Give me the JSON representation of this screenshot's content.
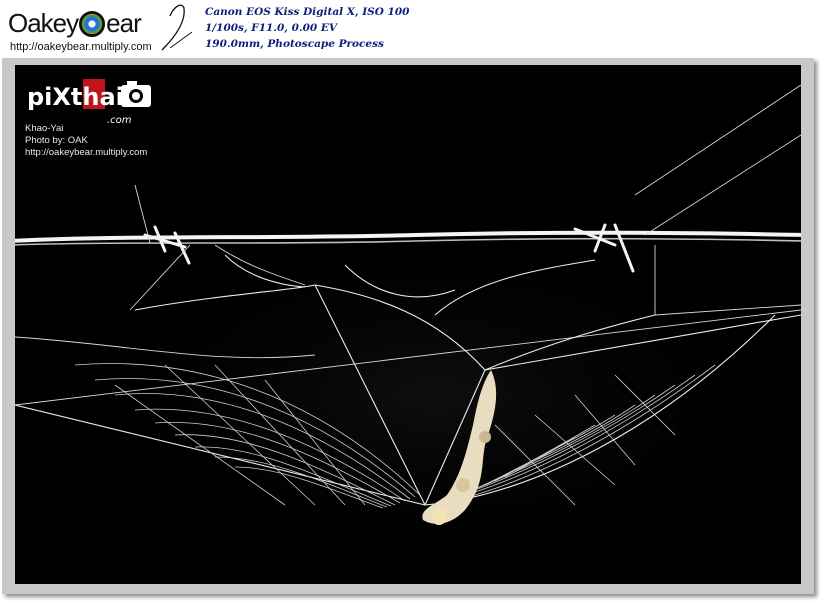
{
  "header": {
    "brand_name": "OakeyBear",
    "brand_url": "http://oakeybear.multiply.com",
    "exif_lines": [
      "Canon EOS Kiss Digital X, ISO 100",
      "1/100s, F11.0, 0.00 EV",
      "190.0mm, Photoscape Process"
    ]
  },
  "photo": {
    "subject": "spider web on barbed wire at night",
    "watermark": {
      "logo_text": "piXthai",
      "logo_suffix": ".com",
      "location": "Khao-Yai",
      "credit": "Photo by: OAK",
      "url": "http://oakeybear.multiply.com"
    }
  },
  "colors": {
    "page_background": "#ffffff",
    "frame": "#c8c8c8",
    "photo_background": "#000000",
    "exif_text": "#0b1f7a",
    "web_strands": "#f2f2f2"
  }
}
